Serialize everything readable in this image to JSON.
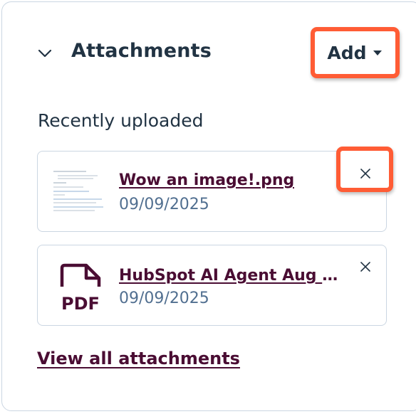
{
  "panel": {
    "title": "Attachments",
    "collapse_icon": "chevron-down-icon",
    "add_button": {
      "label": "Add",
      "icon": "caret-down-icon"
    }
  },
  "section": {
    "label": "Recently uploaded"
  },
  "attachments": [
    {
      "name": "Wow an image!.png",
      "date": "09/09/2025",
      "thumbnail": "image-thumbnail",
      "remove_icon": "close-icon"
    },
    {
      "name": "HubSpot AI Agent Aug 2...",
      "date": "09/09/2025",
      "thumbnail": "pdf-file-icon",
      "thumbnail_label": "PDF",
      "remove_icon": "close-icon"
    }
  ],
  "footer": {
    "view_all_label": "View all attachments"
  },
  "colors": {
    "highlight": "#ff5c35",
    "link": "#4a0d33",
    "heading": "#213343",
    "muted": "#516f90",
    "border": "#cbd6e2"
  }
}
